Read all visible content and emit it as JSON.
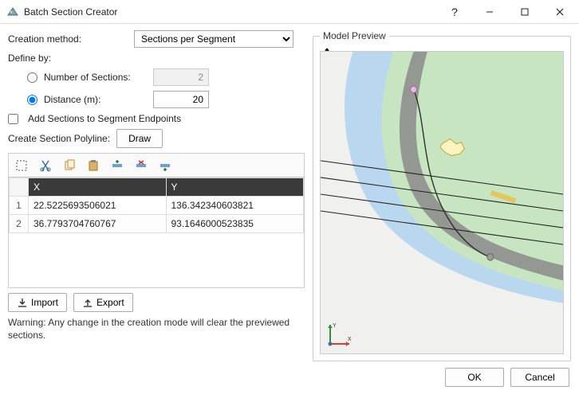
{
  "window": {
    "title": "Batch Section Creator"
  },
  "labels": {
    "creation_method": "Creation method:",
    "define_by": "Define by:",
    "num_sections": "Number of Sections:",
    "distance": "Distance (m):",
    "add_endpoints": "Add Sections to Segment Endpoints",
    "create_polyline": "Create Section Polyline:",
    "preview": "Model Preview"
  },
  "creation_method": {
    "selected": "Sections per Segment",
    "options": [
      "Sections per Segment"
    ]
  },
  "define_by": {
    "mode": "distance",
    "num_sections_value": "2",
    "distance_value": "20"
  },
  "add_endpoints_checked": false,
  "buttons": {
    "draw": "Draw",
    "import": "Import",
    "export": "Export",
    "ok": "OK",
    "cancel": "Cancel"
  },
  "table": {
    "columns": [
      "X",
      "Y"
    ],
    "rows": [
      {
        "idx": "1",
        "x": "22.5225693506021",
        "y": "136.342340603821"
      },
      {
        "idx": "2",
        "x": "36.7793704760767",
        "y": "93.1646000523835"
      }
    ]
  },
  "warning_text": "Warning: Any change in the creation mode will clear the previewed sections.",
  "icons": {
    "pan": "pan-icon",
    "fit": "zoom-fit-icon",
    "axis_x": "X",
    "axis_y": "Y"
  },
  "colors": {
    "water": "#b9d7ef",
    "land": "#c6e5c0",
    "river": "#8b8b8b",
    "axis_x": "#e23a2e",
    "axis_y": "#2f8f3a"
  }
}
